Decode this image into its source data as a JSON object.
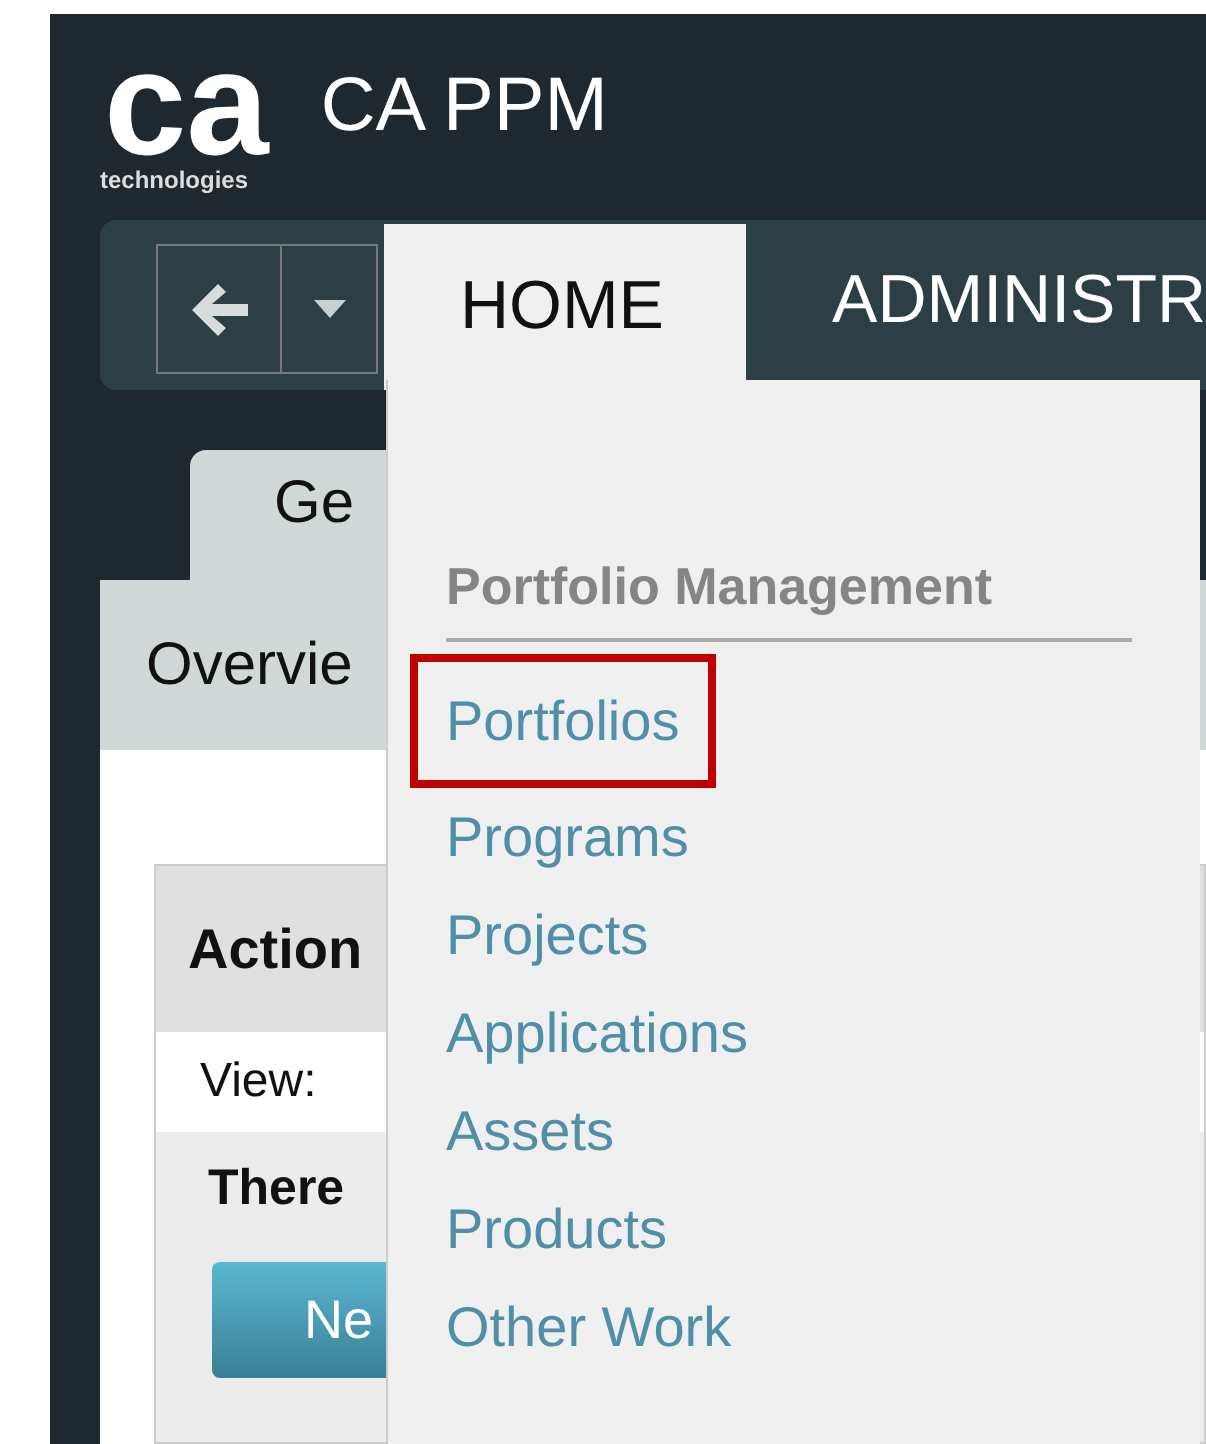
{
  "header": {
    "logo_mark": "ca",
    "logo_sub": "technologies",
    "title": "CA PPM"
  },
  "nav": {
    "tabs": [
      {
        "label": "HOME",
        "selected": true
      },
      {
        "label": "ADMINISTR",
        "selected": false
      }
    ]
  },
  "page": {
    "tab": "Ge",
    "subtab": "Overvie",
    "panel": {
      "title": "Action",
      "view_label": "View:",
      "message": "There",
      "button": "Ne"
    }
  },
  "menu": {
    "heading": "Portfolio Management",
    "items": [
      {
        "label": "Portfolios",
        "highlighted": true
      },
      {
        "label": "Programs",
        "highlighted": false
      },
      {
        "label": "Projects",
        "highlighted": false
      },
      {
        "label": "Applications",
        "highlighted": false
      },
      {
        "label": "Assets",
        "highlighted": false
      },
      {
        "label": "Products",
        "highlighted": false
      },
      {
        "label": "Other Work",
        "highlighted": false
      }
    ]
  }
}
